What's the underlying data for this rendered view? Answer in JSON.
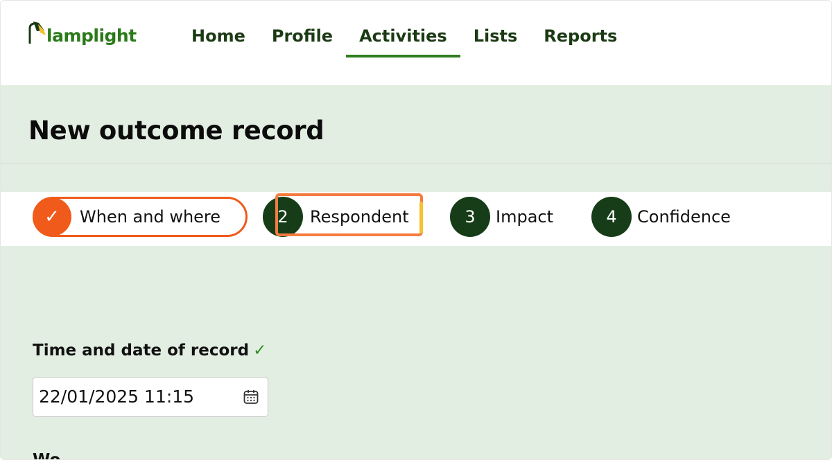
{
  "brand": {
    "name": "lamplight"
  },
  "nav": {
    "items": [
      {
        "label": "Home"
      },
      {
        "label": "Profile"
      },
      {
        "label": "Activities",
        "active": true
      },
      {
        "label": "Lists"
      },
      {
        "label": "Reports"
      }
    ]
  },
  "page": {
    "title": "New outcome record"
  },
  "stepper": {
    "steps": [
      {
        "number": "✓",
        "label": "When and where",
        "state": "completed"
      },
      {
        "number": "2",
        "label": "Respondent",
        "state": "current"
      },
      {
        "number": "3",
        "label": "Impact",
        "state": "upcoming"
      },
      {
        "number": "4",
        "label": "Confidence",
        "state": "upcoming"
      }
    ]
  },
  "form": {
    "time_date": {
      "label": "Time and date of record",
      "check": "✓",
      "value": "22/01/2025 11:15"
    },
    "next_label": "Wo"
  },
  "colors": {
    "brand_green": "#2a7a19",
    "step_dark": "#163d18",
    "step_done": "#f05a1a",
    "highlight": "#f57c3f",
    "band_bg": "#e3eee2"
  },
  "icons": {
    "logo": "lamp-icon",
    "date_picker": "calendar-icon"
  }
}
